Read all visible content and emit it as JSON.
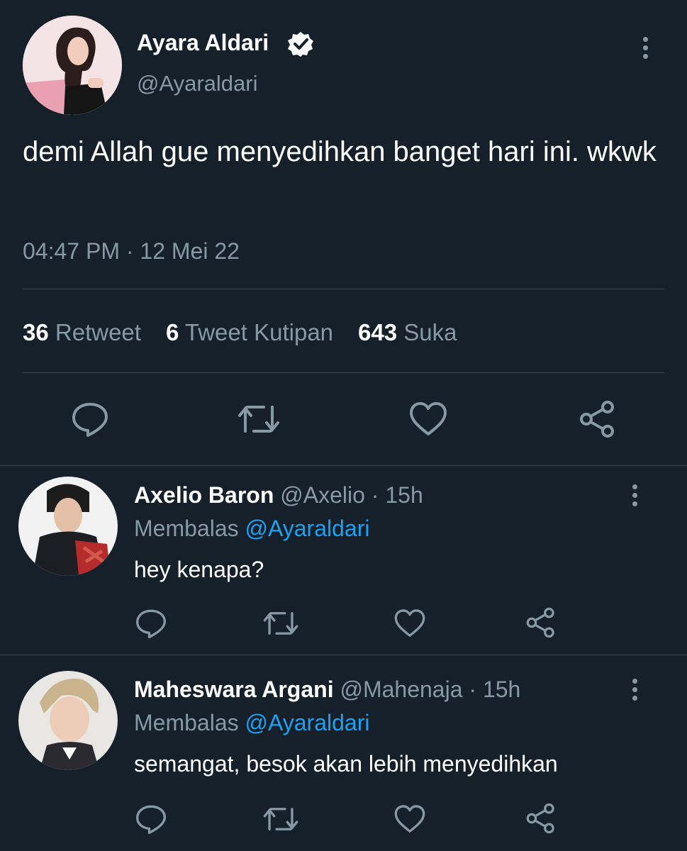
{
  "main_tweet": {
    "author_name": "Ayara Aldari",
    "handle": "@Ayaraldari",
    "text": "demi Allah gue menyedihkan banget hari ini. wkwk",
    "timestamp": "04:47 PM · 12 Mei 22",
    "stats": {
      "retweets_count": "36",
      "retweets_label": "Retweet",
      "quotes_count": "6",
      "quotes_label": "Tweet Kutipan",
      "likes_count": "643",
      "likes_label": "Suka"
    }
  },
  "replies": [
    {
      "author_name": "Axelio Baron",
      "handle_time": "@Axelio · 15h",
      "replying_prefix": "Membalas",
      "replying_to": "@Ayaraldari",
      "text": "hey kenapa?"
    },
    {
      "author_name": "Maheswara Argani",
      "handle_time": "@Mahenaja · 15h",
      "replying_prefix": "Membalas",
      "replying_to": "@Ayaraldari",
      "text": "semangat, besok akan lebih menyedihkan"
    }
  ],
  "colors": {
    "background": "#15202b",
    "muted": "#8899a6",
    "link": "#1da1f2",
    "divider": "#38444d"
  },
  "icons": [
    "verified-badge-icon",
    "more-options-icon",
    "reply-icon",
    "retweet-icon",
    "like-icon",
    "share-icon"
  ]
}
